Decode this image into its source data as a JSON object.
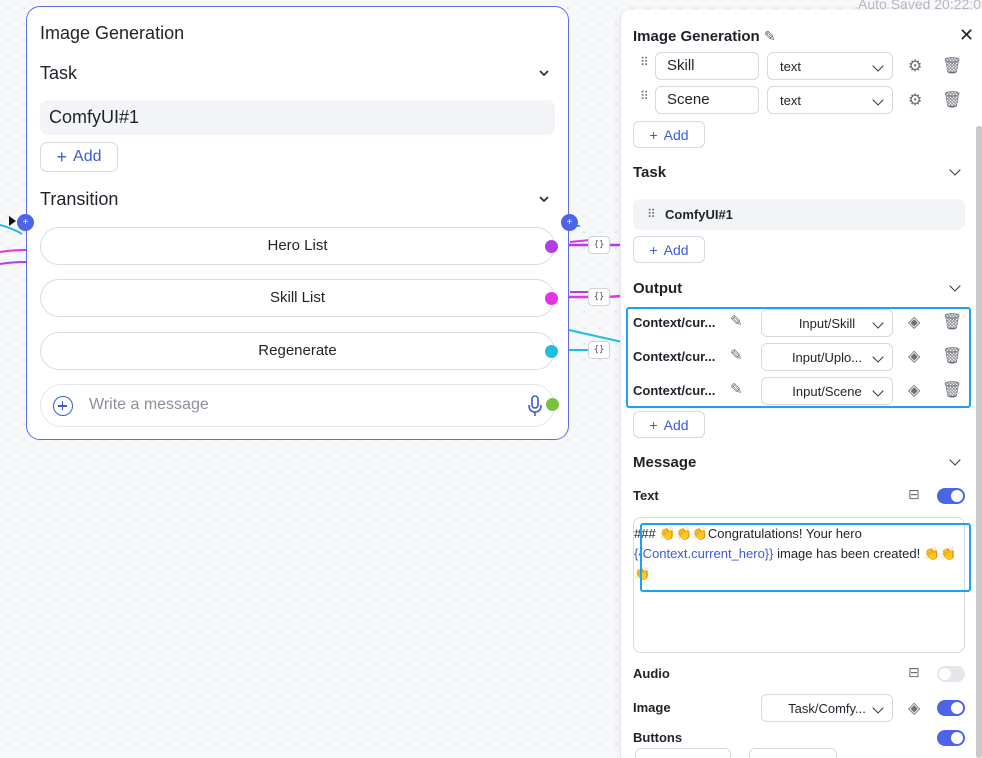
{
  "canvas": {
    "node": {
      "title": "Image Generation",
      "task_section": "Task",
      "task_item": "ComfyUI#1",
      "add_label": "Add",
      "transition_section": "Transition",
      "transitions": [
        {
          "label": "Hero List",
          "color": "#b03de6"
        },
        {
          "label": "Skill List",
          "color": "#e632e0"
        },
        {
          "label": "Regenerate",
          "color": "#21bde0"
        }
      ],
      "message_placeholder": "Write a message",
      "message_port_color": "#7cc241"
    }
  },
  "panel": {
    "autosave": "Auto Saved 20:22:0",
    "title": "Image Generation",
    "inputs": [
      {
        "name": "Skill",
        "type": "text"
      },
      {
        "name": "Scene",
        "type": "text"
      }
    ],
    "add_label": "Add",
    "task_section": "Task",
    "task_item": "ComfyUI#1",
    "output_section": "Output",
    "outputs": [
      {
        "name": "Context/cur...",
        "source": "Input/Skill"
      },
      {
        "name": "Context/cur...",
        "source": "Input/Uplo..."
      },
      {
        "name": "Context/cur...",
        "source": "Input/Scene"
      }
    ],
    "message_section": "Message",
    "text_label": "Text",
    "text_enabled": true,
    "message_text": {
      "prefix": "### 👏👏👏Congratulations! Your hero ",
      "variable": "{{Context.current_hero}}",
      "suffix": " image has been created! 👏👏👏"
    },
    "audio_label": "Audio",
    "audio_enabled": false,
    "image_label": "Image",
    "image_source": "Task/Comfy...",
    "image_enabled": true,
    "buttons_label": "Buttons",
    "buttons_enabled": true,
    "accent_color": "#4d64e6",
    "highlight_color": "#1da1f2"
  }
}
